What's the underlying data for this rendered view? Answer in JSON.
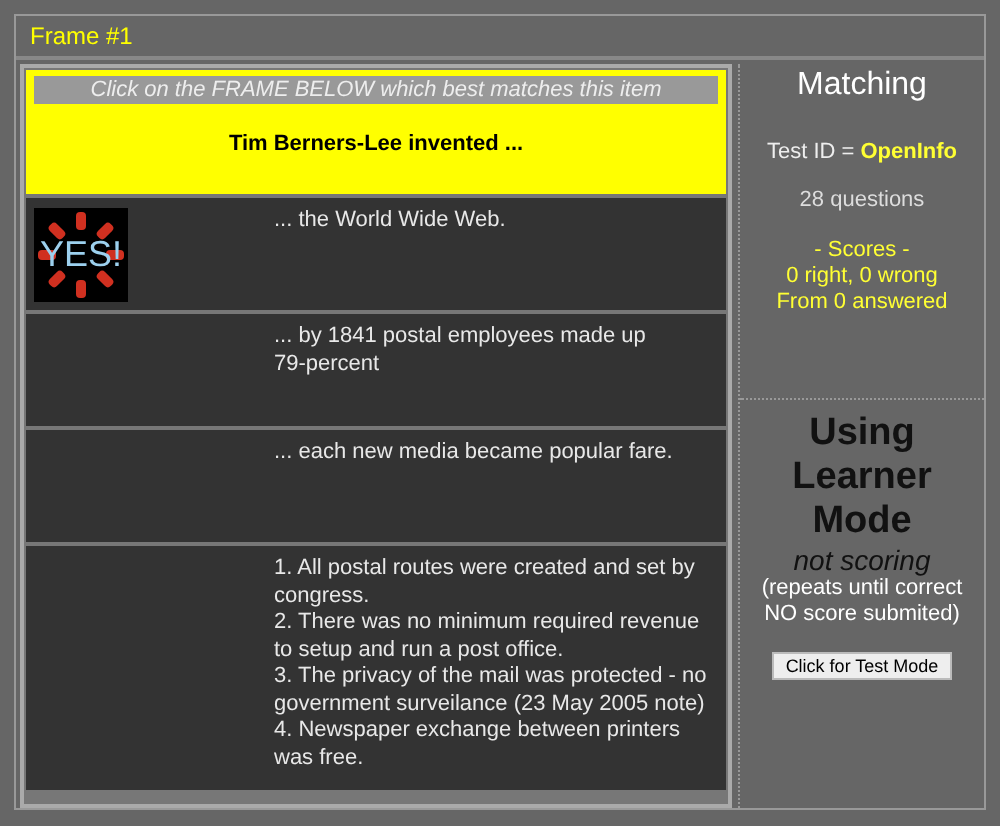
{
  "frame_title": "Frame #1",
  "question": {
    "instruction": "Click on the FRAME BELOW which best matches this item",
    "prompt": "Tim Berners-Lee invented ..."
  },
  "answers": [
    {
      "lines": [
        "... the World Wide Web."
      ],
      "badge": "YES!"
    },
    {
      "lines": [
        "... by 1841 postal employees made up",
        "79-percent"
      ]
    },
    {
      "lines": [
        "... each new media became popular fare."
      ]
    },
    {
      "lines": [
        "1. All postal routes were created and set by congress.",
        "2. There was no minimum required revenue to setup and run a post office.",
        "3. The privacy of the mail was protected - no government surveilance (23 May 2005 note)",
        "4. Newspaper exchange between printers was free."
      ]
    }
  ],
  "sidebar": {
    "title": "Matching",
    "test_id_label": "Test ID =",
    "test_id": "OpenInfo",
    "questions": "28 questions",
    "scores_heading": "- Scores -",
    "scores": "0 right, 0 wrong",
    "answered": "From 0 answered",
    "mode_title": "Using Learner Mode",
    "mode_note": "not scoring",
    "mode_detail": [
      "(repeats until correct",
      "NO score submited)"
    ],
    "mode_button": "Click for Test Mode"
  }
}
